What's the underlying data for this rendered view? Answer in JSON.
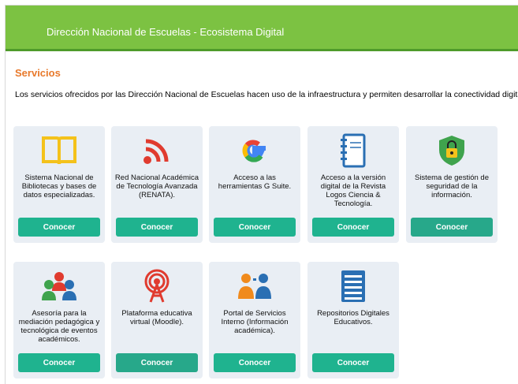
{
  "header": {
    "title": "Dirección Nacional de Escuelas - Ecosistema Digital"
  },
  "section": {
    "title": "Servicios",
    "intro": "Los servicios ofrecidos por las Dirección Nacional de Escuelas hacen uso de la infraestructura y permiten desarrollar la conectividad digital."
  },
  "colors": {
    "header": "#7cc242",
    "accent": "#e8792b",
    "button": "#1fb38f",
    "card": "#e9eef4"
  },
  "cards": [
    {
      "label": "Sistema Nacional de Bibliotecas y bases de datos especializadas.",
      "button": "Conocer",
      "icon": "book-icon"
    },
    {
      "label": "Red Nacional Académica de Tecnología Avanzada (RENATA).",
      "button": "Conocer",
      "icon": "wifi-signal-icon"
    },
    {
      "label": "Acceso a las herramientas G Suite.",
      "button": "Conocer",
      "icon": "google-icon"
    },
    {
      "label": "Acceso a la versión digital de la Revista Logos Ciencia & Tecnología.",
      "button": "Conocer",
      "icon": "notebook-icon"
    },
    {
      "label": "Sistema de gestión de seguridad de la información.",
      "button": "Conocer",
      "icon": "shield-lock-icon"
    },
    {
      "label": "Asesoría para la mediación pedagógica y tecnológica de eventos académicos.",
      "button": "Conocer",
      "icon": "people-group-icon"
    },
    {
      "label": "Plataforma educativa virtual (Moodle).",
      "button": "Conocer",
      "icon": "antenna-icon"
    },
    {
      "label": "Portal de Servicios Interno (Información académica).",
      "button": "Conocer",
      "icon": "users-icon"
    },
    {
      "label": "Repositorios Digitales Educativos.",
      "button": "Conocer",
      "icon": "list-document-icon"
    }
  ]
}
